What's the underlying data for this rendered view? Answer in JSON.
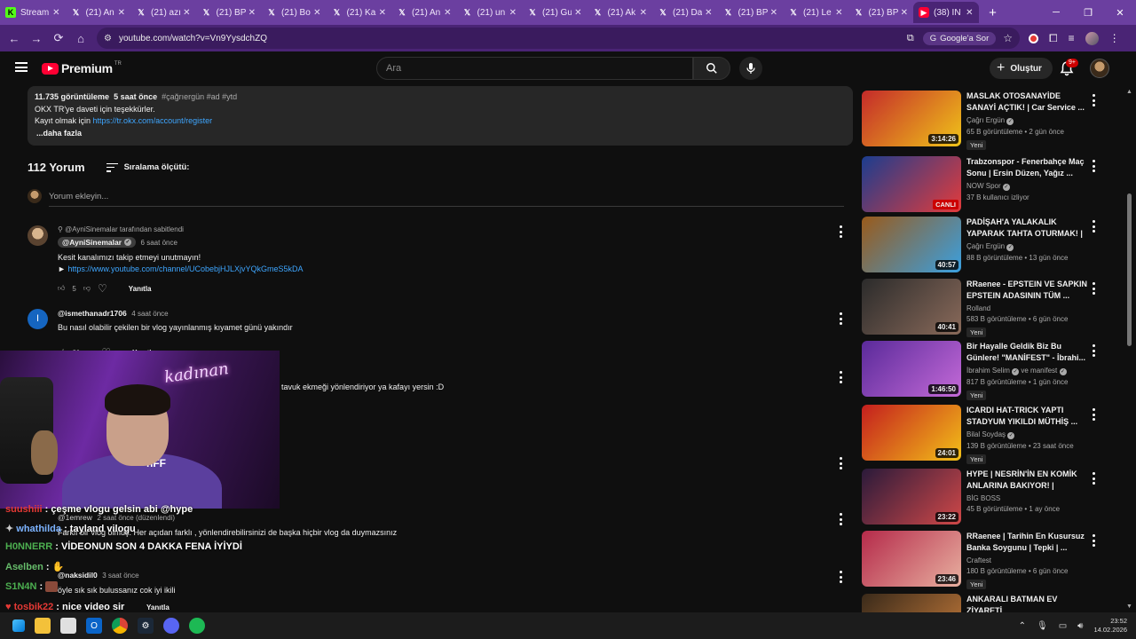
{
  "browser": {
    "tabs": [
      {
        "label": "Stream",
        "icon": "kick-icon"
      },
      {
        "label": "(21) An",
        "icon": "x-icon"
      },
      {
        "label": "(21) azı",
        "icon": "x-icon"
      },
      {
        "label": "(21) BP",
        "icon": "x-icon"
      },
      {
        "label": "(21) Bo",
        "icon": "x-icon"
      },
      {
        "label": "(21) Ka",
        "icon": "x-icon"
      },
      {
        "label": "(21) An",
        "icon": "x-icon"
      },
      {
        "label": "(21) un",
        "icon": "x-icon"
      },
      {
        "label": "(21) Gu",
        "icon": "x-icon"
      },
      {
        "label": "(21) Ak",
        "icon": "x-icon"
      },
      {
        "label": "(21) Da",
        "icon": "x-icon"
      },
      {
        "label": "(21) BP",
        "icon": "x-icon"
      },
      {
        "label": "(21) Le",
        "icon": "x-icon"
      },
      {
        "label": "(21) BP",
        "icon": "x-icon"
      },
      {
        "label": "(38) İN",
        "icon": "yt-icon",
        "active": true
      }
    ],
    "url": "youtube.com/watch?v=Vn9YysdchZQ",
    "google_search_label": "Google'a Sor"
  },
  "yt_header": {
    "logo_text": "Premium",
    "region": "TR",
    "search_placeholder": "Ara",
    "create_label": "Oluştur",
    "notif_count": "9+"
  },
  "description": {
    "views": "11.735 görüntüleme",
    "age": "5 saat önce",
    "tags": "#çağrıergün #ad #ytd",
    "line1": "OKX TR'ye daveti için teşekkürler.",
    "line2_prefix": "Kayıt olmak için",
    "line2_link": "https://tr.okx.com/account/register",
    "more": "...daha fazla"
  },
  "comments_header": {
    "count": "112 Yorum",
    "sort_label": "Sıralama ölçütü:",
    "add_placeholder": "Yorum ekleyin..."
  },
  "comments": [
    {
      "pinned": "@AyniSinemalar tarafından sabitlendi",
      "author": "@AyniSinemalar",
      "time": "6 saat önce",
      "text": "Kesit kanalımızı takip etmeyi unutmayın!",
      "link": "https://www.youtube.com/channel/UCobebjHJLXjvYQkGmeS5kDA",
      "likes": "5",
      "reply": "Yanıtla"
    },
    {
      "author": "@ismethanadr1706",
      "time": "4 saat önce",
      "text": "Bu nasıl olabilir çekilen bir vlog yayınlanmış kıyamet günü yakındır",
      "likes": "61",
      "reply": "Yanıtla"
    },
    {
      "text": "tavuk ekmeği yönlendiriyor ya kafayı yersin :D"
    },
    {
      "author": "@1emrew",
      "time": "2 saat önce (düzenlendi)",
      "text": "Farklı bir vlog olmuş. Her açıdan farklı , yönlendirebilirsinizi de başka hiçbir vlog da duymazsınız"
    },
    {
      "author": "@naksidil0",
      "time": "3 saat önce",
      "text": "öyle sık sık bulussanız cok iyi ikili",
      "reply": "Yanıtla"
    }
  ],
  "webcam": {
    "neon_text": "kadınan",
    "shirt_text": "nFF"
  },
  "chat": [
    {
      "user": "suushiii",
      "msg": "çeşme vlogu gelsin abi @hype",
      "color": "#e53935"
    },
    {
      "user": "whathilda",
      "msg": "tayland vilogu",
      "color": "#7cb3ff"
    },
    {
      "user": "H0NNERR",
      "msg": "VİDEONUN SON 4 DAKKA FENA İYİYDİ",
      "color": "#4caf50"
    },
    {
      "user": "Aselben",
      "msg": "",
      "color": "#66bb6a"
    },
    {
      "user": "S1N4N",
      "msg": "",
      "color": "#4caf50"
    },
    {
      "user": "tosbik22",
      "msg": "nice video sir",
      "color": "#e53935"
    }
  ],
  "recommended": [
    {
      "title": "MASLAK OTOSANAYİDE SANAYİ AÇTIK! | Car Service ...",
      "channel": "Çağrı Ergün",
      "verified": true,
      "stats": "65 B görüntüleme • 2 gün önce",
      "badge": "Yeni",
      "duration": "3:14:26",
      "thumb": [
        "#c42a2a",
        "#f0c419"
      ]
    },
    {
      "title": "Trabzonspor - Fenerbahçe Maç Sonu | Ersin Düzen, Yağız ...",
      "channel": "NOW Spor",
      "verified": true,
      "stats": "37 B kullanıcı izliyor",
      "live": "CANLI",
      "thumb": [
        "#1b3d8f",
        "#e43b3b"
      ]
    },
    {
      "title": "PADİŞAH'A YALAKALIK YAPARAK TAHTA OTURMAK! | ...",
      "channel": "Çağrı Ergün",
      "verified": true,
      "stats": "88 B görüntüleme • 13 gün önce",
      "duration": "40:57",
      "thumb": [
        "#9a5a1a",
        "#3aa0e0"
      ]
    },
    {
      "title": "RRaenee - EPSTEIN VE SAPKIN EPSTEIN ADASININ TÜM ...",
      "channel": "Rolland",
      "verified": false,
      "stats": "583 B görüntüleme • 6 gün önce",
      "badge": "Yeni",
      "duration": "40:41",
      "thumb": [
        "#2b2b2b",
        "#8a6a5a"
      ]
    },
    {
      "title": "Bir Hayalle Geldik Biz Bu Günlere! \"MANİFEST\" - İbrahi...",
      "channel": "İbrahim Selim",
      "channel2": "ve manifest",
      "verified": true,
      "stats": "817 B görüntüleme • 1 gün önce",
      "badge": "Yeni",
      "duration": "1:46:50",
      "thumb": [
        "#5a2a9a",
        "#c46ad8"
      ]
    },
    {
      "title": "ICARDI HAT-TRICK YAPTI STADYUM YIKILDI MÜTHİŞ ...",
      "channel": "Bilal Soydaş",
      "verified": true,
      "stats": "139 B görüntüleme • 23 saat önce",
      "badge": "Yeni",
      "duration": "24:01",
      "thumb": [
        "#c41e1e",
        "#f3c018"
      ]
    },
    {
      "title": "HYPE | NESRİN'İN EN KOMİK ANLARINA BAKIYOR! | JAHREI...",
      "channel": "BİG BOSS",
      "verified": false,
      "stats": "45 B görüntüleme • 1 ay önce",
      "duration": "23:22",
      "thumb": [
        "#2a1a3a",
        "#d04848"
      ]
    },
    {
      "title": "RRaenee | Tarihin En Kusursuz Banka Soygunu | Tepki | ...",
      "channel": "Craftest",
      "verified": false,
      "stats": "180 B görüntüleme • 6 gün önce",
      "badge": "Yeni",
      "duration": "23:46",
      "thumb": [
        "#b52a4a",
        "#e8b0a0"
      ]
    },
    {
      "title": "ANKARALI BATMAN EV ZİYARETİ",
      "channel": "",
      "verified": false,
      "stats": "",
      "thumb": [
        "#3a2a1a",
        "#c47a3a"
      ]
    }
  ],
  "taskbar": {
    "time": "23:52",
    "date": "14.02.2026"
  },
  "colors": {
    "tab_bar": "#6b3fa0",
    "address_bar": "#4a2475",
    "yt_bg": "#0f0f0f",
    "link": "#3ea6ff",
    "yt_red": "#ff0033"
  }
}
